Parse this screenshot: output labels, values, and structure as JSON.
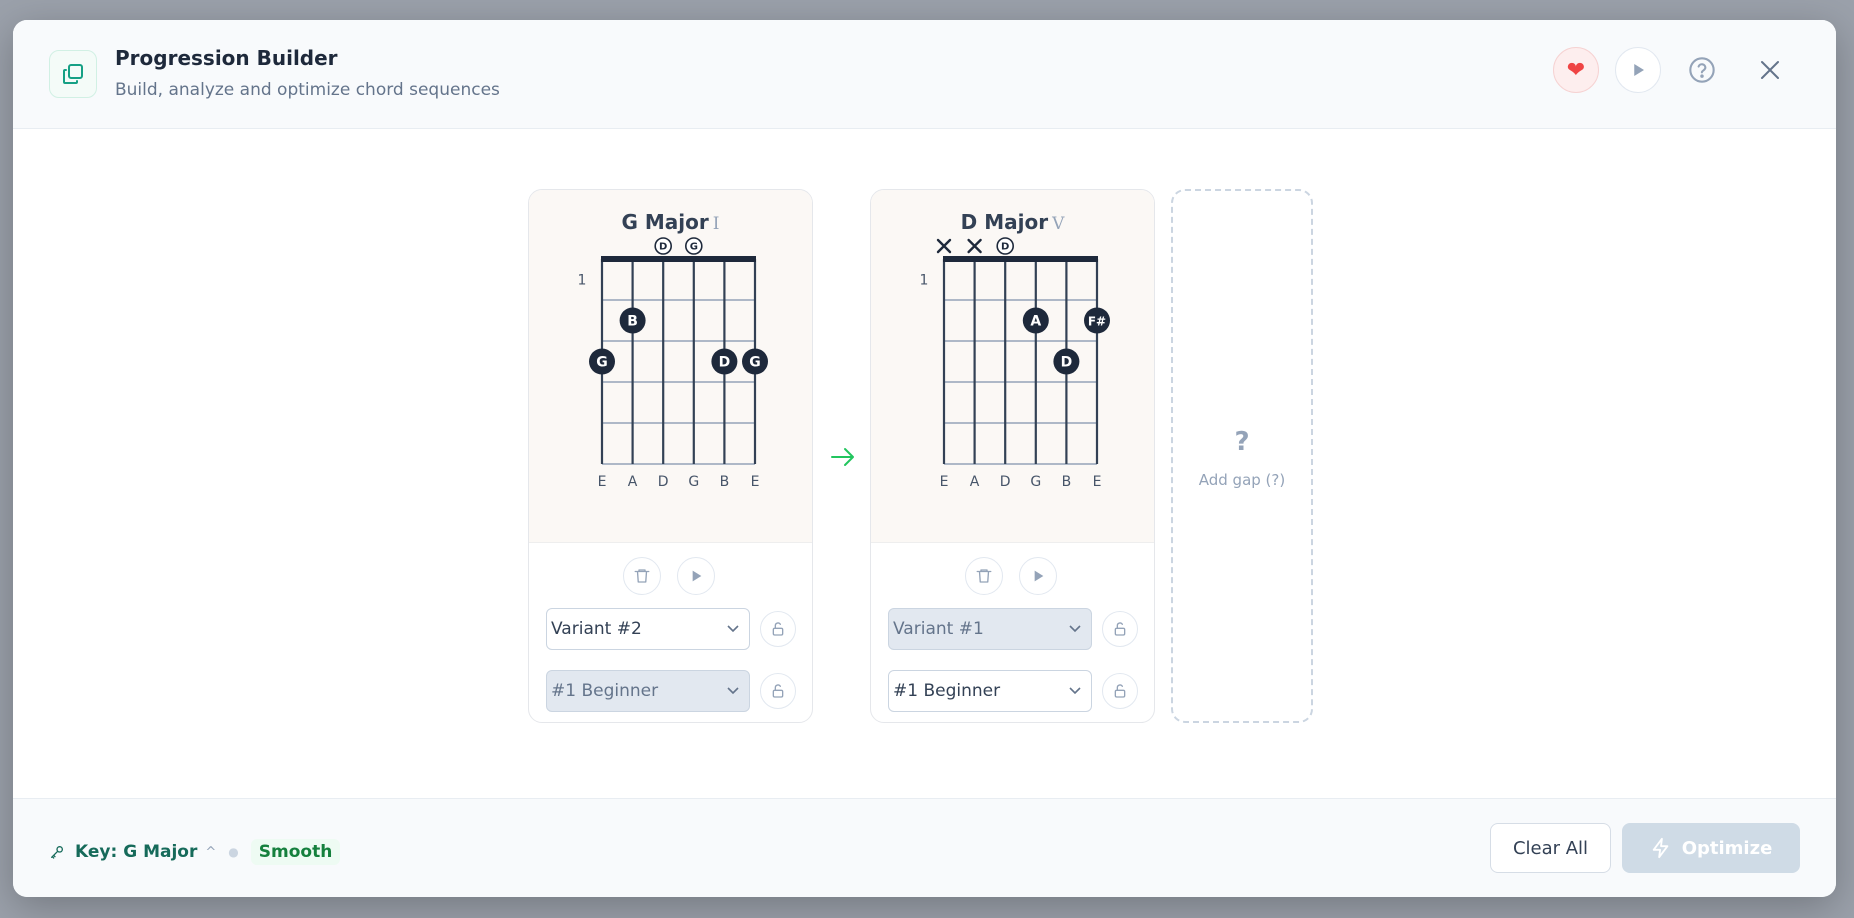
{
  "header": {
    "title": "Progression Builder",
    "subtitle": "Build, analyze and optimize chord sequences",
    "icons": [
      "copy-icon",
      "heart-icon",
      "play-icon",
      "help-icon",
      "close-icon"
    ]
  },
  "chords": [
    {
      "name": "G Major",
      "roman": "I",
      "fret_start": "1",
      "strings": [
        "E",
        "A",
        "D",
        "G",
        "B",
        "E"
      ],
      "open_notes": [
        "",
        "",
        "D",
        "G",
        "",
        ""
      ],
      "muted": [
        false,
        false,
        false,
        false,
        false,
        false
      ],
      "fingers": [
        {
          "string": 0,
          "fret": 3,
          "note": "G"
        },
        {
          "string": 1,
          "fret": 2,
          "note": "B"
        },
        {
          "string": 4,
          "fret": 3,
          "note": "D"
        },
        {
          "string": 5,
          "fret": 3,
          "note": "G"
        }
      ],
      "variant": "Variant #2",
      "variant_disabled": false,
      "difficulty": "#1 Beginner",
      "difficulty_disabled": true
    },
    {
      "name": "D Major",
      "roman": "V",
      "fret_start": "1",
      "strings": [
        "E",
        "A",
        "D",
        "G",
        "B",
        "E"
      ],
      "open_notes": [
        "",
        "",
        "D",
        "",
        "",
        ""
      ],
      "muted": [
        true,
        true,
        false,
        false,
        false,
        false
      ],
      "fingers": [
        {
          "string": 3,
          "fret": 2,
          "note": "A"
        },
        {
          "string": 5,
          "fret": 2,
          "note": "F#"
        },
        {
          "string": 4,
          "fret": 3,
          "note": "D"
        }
      ],
      "variant": "Variant #1",
      "variant_disabled": true,
      "difficulty": "#1 Beginner",
      "difficulty_disabled": false
    }
  ],
  "add_gap": {
    "symbol": "?",
    "label": "Add gap (?)"
  },
  "footer": {
    "key_label": "Key: G Major",
    "feel_label": "Smooth",
    "clear_label": "Clear All",
    "optimize_label": "Optimize"
  },
  "colors": {
    "accent": "#166a5a",
    "heart": "#ef4444",
    "arrow": "#22c55e",
    "finger_dot": "#1e293b",
    "optimize_disabled": "#cfdbe6"
  }
}
